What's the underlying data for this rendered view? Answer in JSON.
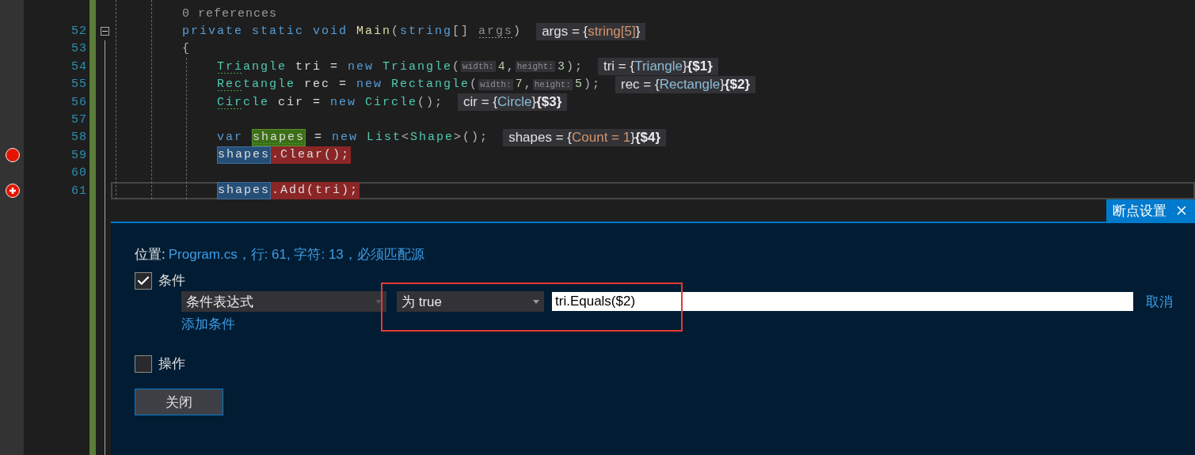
{
  "editor": {
    "lines": [
      {
        "kind": "codelens",
        "text": "0 references"
      },
      {
        "kind": "code",
        "number": "52",
        "foldable": true,
        "segments": [
          {
            "kind": "code",
            "tokens": [
              {
                "text": "private static void ",
                "kind": "keyword"
              },
              {
                "text": "Main",
                "kind": "method"
              },
              {
                "text": "(",
                "kind": "punct"
              },
              {
                "text": "string",
                "kind": "keyword"
              },
              {
                "text": "[] ",
                "kind": "punct"
              },
              {
                "text": "args",
                "kind": "unused",
                "suggestion": true
              },
              {
                "text": ")",
                "kind": "punct"
              }
            ]
          }
        ],
        "datatip": [
          {
            "text": "args = {",
            "kind": "plain"
          },
          {
            "text": "string[5]",
            "kind": "value"
          },
          {
            "text": "}",
            "kind": "plain"
          }
        ]
      },
      {
        "kind": "code",
        "number": "53",
        "segments": [
          {
            "kind": "code",
            "tokens": [
              {
                "text": "{",
                "kind": "punct"
              }
            ]
          }
        ],
        "children": [
          {
            "kind": "code",
            "number": "54",
            "segments": [
              {
                "kind": "code",
                "tokens": [
                  {
                    "text": "Tri",
                    "kind": "type",
                    "suggestion": true
                  },
                  {
                    "text": "angle",
                    "kind": "type"
                  },
                  {
                    "text": " tri = ",
                    "kind": "plain"
                  },
                  {
                    "text": "new ",
                    "kind": "keyword"
                  },
                  {
                    "text": "Triangle",
                    "kind": "type"
                  },
                  {
                    "text": "(",
                    "kind": "punct"
                  }
                ]
              },
              {
                "kind": "hint",
                "text": "width:"
              },
              {
                "kind": "code",
                "tokens": [
                  {
                    "text": "4",
                    "kind": "number"
                  },
                  {
                    "text": ",",
                    "kind": "punct"
                  }
                ]
              },
              {
                "kind": "hint",
                "text": "height:"
              },
              {
                "kind": "code",
                "tokens": [
                  {
                    "text": "3",
                    "kind": "number"
                  },
                  {
                    "text": ");",
                    "kind": "punct"
                  }
                ]
              }
            ],
            "datatip": [
              {
                "text": "tri = {",
                "kind": "plain"
              },
              {
                "text": "Triangle",
                "kind": "type"
              },
              {
                "text": "}",
                "kind": "plain"
              },
              {
                "text": "{$1}",
                "kind": "id"
              }
            ]
          },
          {
            "kind": "code",
            "number": "55",
            "segments": [
              {
                "kind": "code",
                "tokens": [
                  {
                    "text": "Rec",
                    "kind": "type",
                    "suggestion": true
                  },
                  {
                    "text": "tangle",
                    "kind": "type"
                  },
                  {
                    "text": " rec = ",
                    "kind": "plain"
                  },
                  {
                    "text": "new ",
                    "kind": "keyword"
                  },
                  {
                    "text": "Rectangle",
                    "kind": "type"
                  },
                  {
                    "text": "(",
                    "kind": "punct"
                  }
                ]
              },
              {
                "kind": "hint",
                "text": "width:"
              },
              {
                "kind": "code",
                "tokens": [
                  {
                    "text": "7",
                    "kind": "number"
                  },
                  {
                    "text": ",",
                    "kind": "punct"
                  }
                ]
              },
              {
                "kind": "hint",
                "text": "height:"
              },
              {
                "kind": "code",
                "tokens": [
                  {
                    "text": "5",
                    "kind": "number"
                  },
                  {
                    "text": ");",
                    "kind": "punct"
                  }
                ]
              }
            ],
            "datatip": [
              {
                "text": "rec = {",
                "kind": "plain"
              },
              {
                "text": "Rectangle",
                "kind": "type"
              },
              {
                "text": "}",
                "kind": "plain"
              },
              {
                "text": "{$2}",
                "kind": "id"
              }
            ]
          },
          {
            "kind": "code",
            "number": "56",
            "segments": [
              {
                "kind": "code",
                "tokens": [
                  {
                    "text": "Cir",
                    "kind": "type",
                    "suggestion": true
                  },
                  {
                    "text": "cle",
                    "kind": "type"
                  },
                  {
                    "text": " cir = ",
                    "kind": "plain"
                  },
                  {
                    "text": "new ",
                    "kind": "keyword"
                  },
                  {
                    "text": "Circle",
                    "kind": "type"
                  },
                  {
                    "text": "();",
                    "kind": "punct"
                  }
                ]
              }
            ],
            "datatip": [
              {
                "text": "cir = {",
                "kind": "plain"
              },
              {
                "text": "Circle",
                "kind": "type"
              },
              {
                "text": "}",
                "kind": "plain"
              },
              {
                "text": "{$3}",
                "kind": "id"
              }
            ]
          },
          {
            "kind": "code",
            "number": "57"
          },
          {
            "kind": "code",
            "number": "58",
            "segments": [
              {
                "kind": "code",
                "tokens": [
                  {
                    "text": "var",
                    "kind": "keyword"
                  }
                ]
              },
              {
                "kind": "definition",
                "tokens": [
                  {
                    "text": "shapes",
                    "kind": "plain",
                    "suggestion": true
                  }
                ]
              },
              {
                "kind": "code",
                "tokens": [
                  {
                    "text": "= ",
                    "kind": "plain"
                  },
                  {
                    "text": "new ",
                    "kind": "keyword"
                  },
                  {
                    "text": "List",
                    "kind": "type"
                  },
                  {
                    "text": "<",
                    "kind": "punct"
                  },
                  {
                    "text": "Shape",
                    "kind": "type"
                  },
                  {
                    "text": ">();",
                    "kind": "punct"
                  }
                ]
              }
            ],
            "datatip": [
              {
                "text": "shapes = {",
                "kind": "plain"
              },
              {
                "text": "Count = 1",
                "kind": "value"
              },
              {
                "text": "}",
                "kind": "plain"
              },
              {
                "text": "{$4}",
                "kind": "id"
              }
            ]
          },
          {
            "kind": "code",
            "number": "59",
            "breakpoint": true,
            "conditional": false,
            "segments": [
              {
                "kind": "reference",
                "tokens": [
                  {
                    "text": "shapes",
                    "kind": "plain"
                  }
                ]
              },
              {
                "kind": "breakpoint",
                "tokens": [
                  {
                    "text": ".Clear();",
                    "kind": "plain"
                  }
                ]
              }
            ]
          },
          {
            "kind": "code",
            "number": "60"
          },
          {
            "kind": "code",
            "number": "61",
            "breakpoint": true,
            "conditional": true,
            "current": true,
            "segments": [
              {
                "kind": "reference",
                "tokens": [
                  {
                    "text": "shapes",
                    "kind": "plain"
                  }
                ]
              },
              {
                "kind": "breakpoint",
                "tokens": [
                  {
                    "text": ".Add(tri);",
                    "kind": "plain"
                  }
                ]
              }
            ]
          }
        ]
      }
    ]
  },
  "breakpoint_settings": {
    "tab": {
      "title": "断点设置",
      "selected": true
    },
    "location": {
      "label": "位置:",
      "value": "Program.cs，行: 61, 字符: 13，必须匹配源"
    },
    "conditions": {
      "label": "条件",
      "checked": true,
      "rows": [
        {
          "type": "条件表达式",
          "test": "为 true",
          "expression": "tri.Equals($2)",
          "cancel": "取消"
        }
      ],
      "add": "添加条件"
    },
    "actions": {
      "label": "操作",
      "checked": false
    },
    "close_button": "关闭"
  }
}
